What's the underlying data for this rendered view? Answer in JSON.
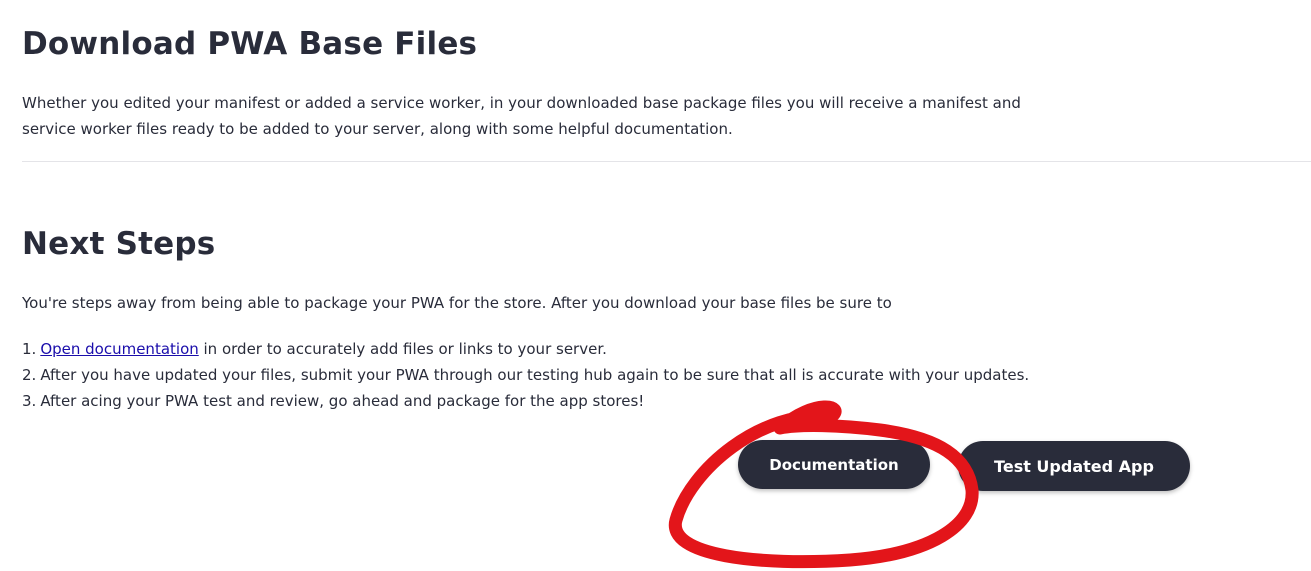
{
  "download_section": {
    "title": "Download PWA Base Files",
    "description": "Whether you edited your manifest or added a service worker, in your downloaded base package files you will receive a manifest and service worker files ready to be added to your server, along with some helpful documentation."
  },
  "next_steps": {
    "title": "Next Steps",
    "intro": "You're steps away from being able to package your PWA for the store. After you download your base files be sure to",
    "steps": [
      {
        "num": "1.",
        "link": "Open documentation",
        "text": " in order to accurately add files or links to your server."
      },
      {
        "num": "2.",
        "text": "After you have updated your files, submit your PWA through our testing hub again to be sure that all is accurate with your updates."
      },
      {
        "num": "3.",
        "text": "After acing your PWA test and review, go ahead and package for the app stores!"
      }
    ]
  },
  "buttons": {
    "documentation": "Documentation",
    "test_updated_app": "Test Updated App"
  },
  "colors": {
    "text_dark": "#292c3a",
    "button_bg": "#292c3a",
    "link": "#1a0dab",
    "annotation_stroke": "#e3151a"
  }
}
